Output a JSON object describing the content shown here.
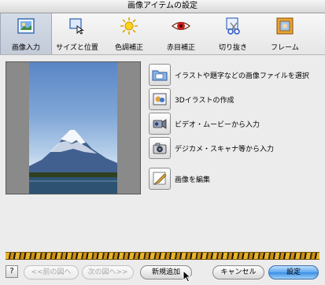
{
  "window": {
    "title": "画像アイテムの設定"
  },
  "toolbar": {
    "items": [
      {
        "label": "画像入力",
        "icon": "image-input-icon",
        "selected": true
      },
      {
        "label": "サイズと位置",
        "icon": "size-position-icon",
        "selected": false
      },
      {
        "label": "色調補正",
        "icon": "color-correction-icon",
        "selected": false
      },
      {
        "label": "赤目補正",
        "icon": "red-eye-icon",
        "selected": false
      },
      {
        "label": "切り抜き",
        "icon": "crop-icon",
        "selected": false
      },
      {
        "label": "フレーム",
        "icon": "frame-icon",
        "selected": false
      }
    ]
  },
  "actions": [
    {
      "label": "イラストや題字などの画像ファイルを選択",
      "icon": "folder-icon"
    },
    {
      "label": "3Dイラストの作成",
      "icon": "3d-illustration-icon"
    },
    {
      "label": "ビデオ・ムービーから入力",
      "icon": "video-camera-icon"
    },
    {
      "label": "デジカメ・スキャナ等から入力",
      "icon": "digital-camera-icon"
    },
    {
      "label": "画像を編集",
      "icon": "edit-image-icon"
    }
  ],
  "footer": {
    "help_label": "?",
    "prev_label": "<<前の図へ",
    "next_label": "次の図へ>>",
    "new_add_label": "新規追加",
    "cancel_label": "キャンセル",
    "ok_label": "設定"
  },
  "colors": {
    "accent": "#3a8fe6",
    "selected_tab": "#c8cfdc"
  }
}
